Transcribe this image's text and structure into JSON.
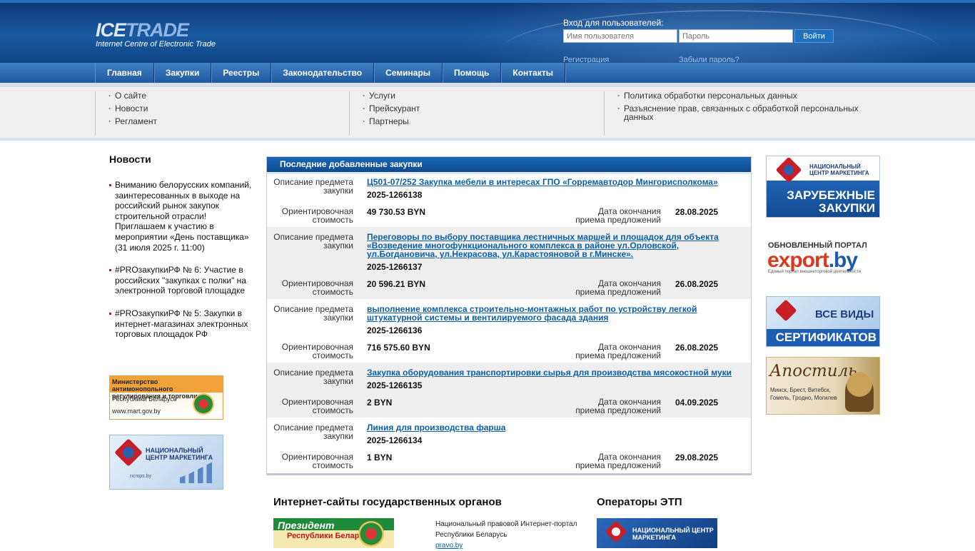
{
  "header": {
    "logo_main_a": "ICE",
    "logo_main_b": "TRADE",
    "logo_sub": "Internet Centre of Electronic Trade",
    "login_label": "Вход для пользователей:",
    "username_placeholder": "Имя пользователя",
    "password_placeholder": "Пароль",
    "login_button": "Войти",
    "register_link": "Регистрация",
    "forgot_link": "Забыли пароль?"
  },
  "nav": [
    "Главная",
    "Закупки",
    "Реестры",
    "Законодательство",
    "Семинары",
    "Помощь",
    "Контакты"
  ],
  "submenu": {
    "col1": [
      "О сайте",
      "Новости",
      "Регламент"
    ],
    "col2": [
      "Услуги",
      "Прейскурант",
      "Партнеры"
    ],
    "col3": [
      "Политика обработки персональных данных",
      "Разъяснение прав, связанных с обработкой персональных данных"
    ]
  },
  "news": {
    "title": "Новости",
    "items": [
      "Вниманию белорусских компаний, заинтересованных в выходе на российский рынок закупок строительной отрасли! Приглашаем к участию в мероприятии «День поставщика» (31 июля 2025 г. 11:00)",
      "#PROзакупкиРФ № 6: Участие в российских \"закупках с полки\" на электронной торговой площадке",
      "#PROзакупкиРФ № 5: Закупки в интернет-магазинах электронных торговых площадок РФ"
    ]
  },
  "left_banners": {
    "mart_line1": "Министерство антимонопольного регулирования и торговли",
    "mart_line2": "Республики Беларусь",
    "mart_url": "www.mart.gov.by",
    "ncm_text": "НАЦИОНАЛЬНЫЙ ЦЕНТР МАРКЕТИНГА",
    "ncm_url": "ncmps.by"
  },
  "procurements": {
    "title": "Последние добавленные закупки",
    "label_subject": "Описание предмета закупки",
    "label_cost": "Ориентировочная стоимость",
    "label_deadline": "Дата окончания приема предложений",
    "items": [
      {
        "subject": "Ц501-07/252 Закупка мебели в интересах ГПО «Горремавтодор Мингорисполкома»",
        "number": "2025-1266138",
        "cost": "49 730.53 BYN",
        "deadline": "28.08.2025"
      },
      {
        "subject": "Переговоры по выбору поставщика лестничных маршей и площадок для объекта «Возведение многофункционального комплекса в районе ул.Орловской, ул.Богдановича, ул.Некрасова, ул.Карастояновой в г.Минске».",
        "number": "2025-1266137",
        "cost": "20 596.21 BYN",
        "deadline": "26.08.2025"
      },
      {
        "subject": "выполнение комплекса строительно-монтажных работ по устройству легкой штукатурной системы и вентилируемого фасада здания",
        "number": "2025-1266136",
        "cost": "716 575.60 BYN",
        "deadline": "26.08.2025"
      },
      {
        "subject": "Закупка оборудования транспортировки сырья для производства мясокостной муки",
        "number": "2025-1266135",
        "cost": "2 BYN",
        "deadline": "04.09.2025"
      },
      {
        "subject": "Линия для производства фарша",
        "number": "2025-1266134",
        "cost": "1 BYN",
        "deadline": "29.08.2025"
      }
    ]
  },
  "right_banners": {
    "b1_small": "НАЦИОНАЛЬНЫЙ ЦЕНТР МАРКЕТИНГА",
    "b1_big": "ЗАРУБЕЖНЫЕ ЗАКУПКИ",
    "b2_top": "ОБНОВЛЕННЫЙ ПОРТАЛ",
    "b2_main_a": "export",
    "b2_main_b": ".by",
    "b2_sub": "Единый портал внешнеторговой деятельности",
    "b3_top": "ВСЕ ВИДЫ",
    "b3_bottom": "СЕРТИФИКАТОВ",
    "b4_title": "Апостиль",
    "b4_cities": "Минск, Брест, Витебск, Гомель, Гродно, Могилев"
  },
  "bottom": {
    "gov_title": "Интернет-сайты государственных органов",
    "etp_title": "Операторы ЭТП",
    "pres_line1": "Президент",
    "pres_line2": "Республики Беларусь",
    "pravo_text": "Национальный правовой Интернет-портал Республики Беларусь",
    "pravo_link": "pravo.by",
    "ncm_etp_text": "НАЦИОНАЛЬНЫЙ ЦЕНТР МАРКЕТИНГА"
  }
}
